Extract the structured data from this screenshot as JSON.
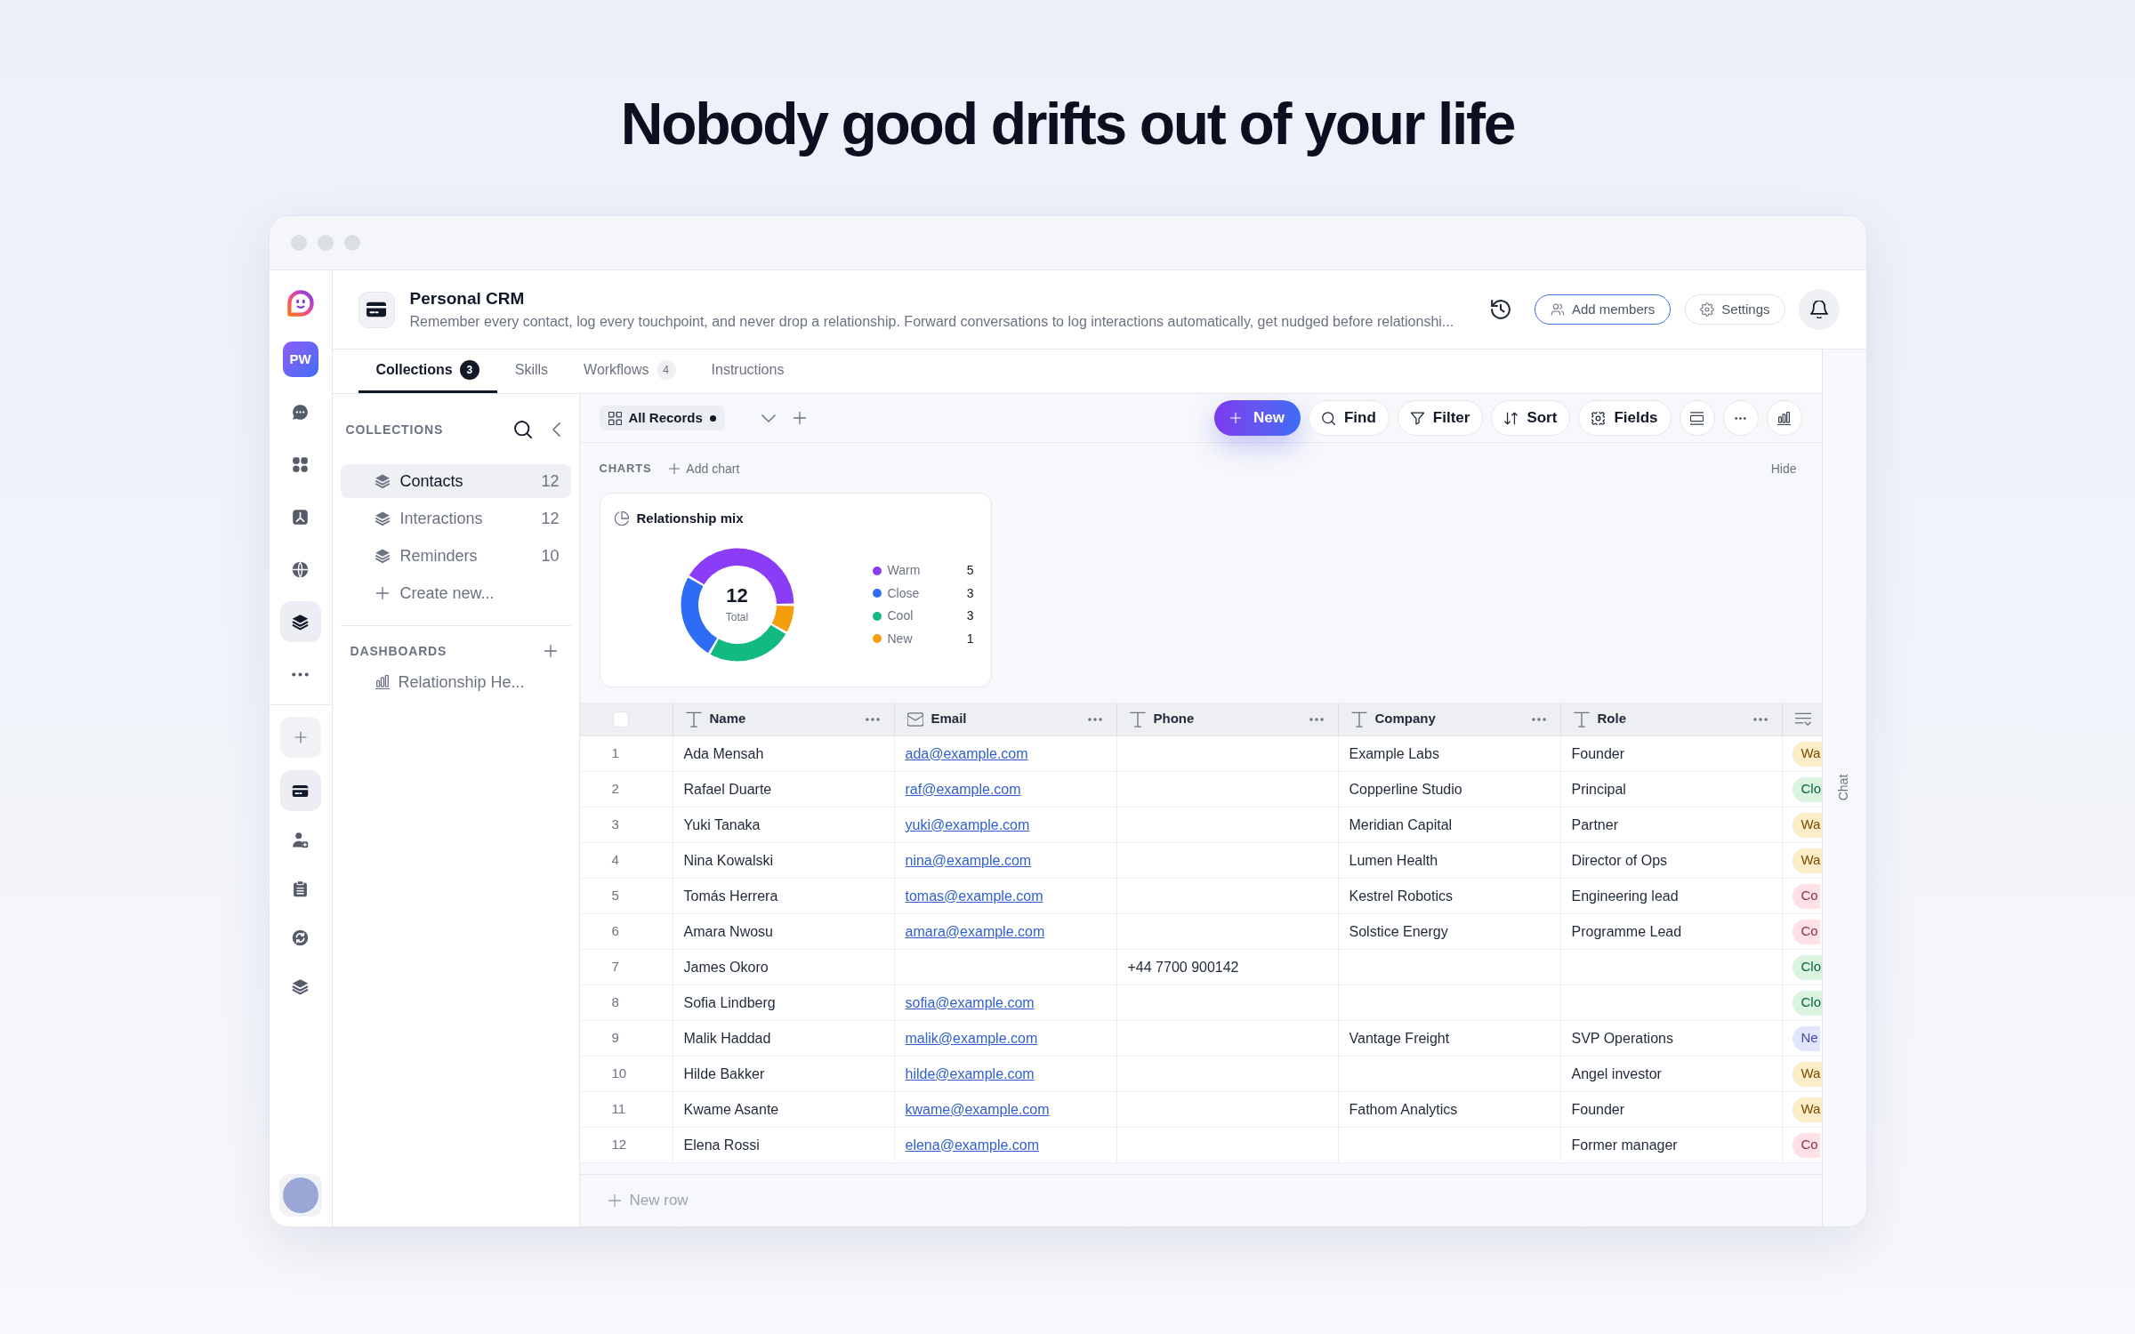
{
  "headline": "Nobody good drifts out of your life",
  "rail": {
    "workspace_badge": "PW",
    "apps": [
      {
        "selected": false
      },
      {
        "selected": false
      },
      {
        "selected": false
      },
      {
        "selected": false
      },
      {
        "selected": true
      }
    ],
    "pinned": [
      {
        "selected": true
      },
      {
        "selected": false
      },
      {
        "selected": false
      },
      {
        "selected": false
      },
      {
        "selected": false
      }
    ]
  },
  "workspace": {
    "title": "Personal CRM",
    "description": "Remember every contact, log every touchpoint, and never drop a relationship. Forward conversations to log interactions automatically, get nudged before relationshi...",
    "actions": [
      {
        "label": "Add members",
        "kind": "accent"
      },
      {
        "label": "Settings",
        "kind": "plain"
      }
    ]
  },
  "tabs": [
    {
      "label": "Collections",
      "badge": "3",
      "selected": true
    },
    {
      "label": "Skills",
      "selected": false
    },
    {
      "label": "Workflows",
      "badge": "4",
      "selected": false
    },
    {
      "label": "Instructions",
      "selected": false
    }
  ],
  "collections": {
    "heading": "COLLECTIONS",
    "items": [
      {
        "label": "Contacts",
        "count": "12",
        "selected": true
      },
      {
        "label": "Interactions",
        "count": "12",
        "selected": false
      },
      {
        "label": "Reminders",
        "count": "10",
        "selected": false
      }
    ],
    "create_label": "Create new..."
  },
  "dashboards": {
    "heading": "DASHBOARDS",
    "items": [
      {
        "label": "Relationship He...",
        "selected": false
      }
    ]
  },
  "toolbar": {
    "view": {
      "label": "All Records",
      "dot": true
    },
    "actions": [
      {
        "label": "New",
        "kind": "primary"
      },
      {
        "label": "Find",
        "kind": "plain"
      },
      {
        "label": "Filter",
        "kind": "plain"
      },
      {
        "label": "Sort",
        "kind": "plain"
      },
      {
        "label": "Fields",
        "kind": "plain"
      }
    ]
  },
  "charts": {
    "heading": "CHARTS",
    "add_label": "Add chart",
    "hide_label": "Hide",
    "cards": [
      {
        "chart_data": {
          "type": "donut",
          "title": "Relationship mix",
          "categories": [
            "Warm",
            "Close",
            "Cool",
            "New"
          ],
          "values": [
            41.67,
            25,
            25,
            8.33
          ]
        },
        "legend": [
          {
            "color": "#8b3cf6",
            "value": "5"
          },
          {
            "color": "#2f6cf5",
            "value": "3"
          },
          {
            "color": "#12b981",
            "value": "3"
          },
          {
            "color": "#f59e0b",
            "value": "1"
          }
        ],
        "total": {
          "value": "12",
          "label": "Total"
        }
      }
    ]
  },
  "table": {
    "select_all": {
      "checked": false
    },
    "columns": [
      {
        "label": "Name",
        "kind": "text"
      },
      {
        "label": "Email",
        "kind": "email"
      },
      {
        "label": "Phone",
        "kind": "text"
      },
      {
        "label": "Company",
        "kind": "text"
      },
      {
        "label": "Role",
        "kind": "text"
      },
      {
        "kind": "select"
      }
    ],
    "rows": [
      {
        "number": "1",
        "cells": [
          "Ada Mensah",
          "ada@example.com",
          null,
          "Example Labs",
          "Founder"
        ],
        "status": {
          "label": "Wa",
          "color": "#fdecc8"
        }
      },
      {
        "number": "2",
        "cells": [
          "Rafael Duarte",
          "raf@example.com",
          null,
          "Copperline Studio",
          "Principal"
        ],
        "status": {
          "label": "Clo",
          "color": "#dcf5e3"
        }
      },
      {
        "number": "3",
        "cells": [
          "Yuki Tanaka",
          "yuki@example.com",
          null,
          "Meridian Capital",
          "Partner"
        ],
        "status": {
          "label": "Wa",
          "color": "#fdecc8"
        }
      },
      {
        "number": "4",
        "cells": [
          "Nina Kowalski",
          "nina@example.com",
          null,
          "Lumen Health",
          "Director of Ops"
        ],
        "status": {
          "label": "Wa",
          "color": "#fdecc8"
        }
      },
      {
        "number": "5",
        "cells": [
          "Tomás Herrera",
          "tomas@example.com",
          null,
          "Kestrel Robotics",
          "Engineering lead"
        ],
        "status": {
          "label": "Co",
          "color": "#fde1e6"
        }
      },
      {
        "number": "6",
        "cells": [
          "Amara Nwosu",
          "amara@example.com",
          null,
          "Solstice Energy",
          "Programme Lead"
        ],
        "status": {
          "label": "Co",
          "color": "#fde1e6"
        }
      },
      {
        "number": "7",
        "cells": [
          "James Okoro",
          null,
          "+44 7700 900142",
          null,
          null
        ],
        "status": {
          "label": "Clo",
          "color": "#dcf5e3"
        }
      },
      {
        "number": "8",
        "cells": [
          "Sofia Lindberg",
          "sofia@example.com",
          null,
          null,
          null
        ],
        "status": {
          "label": "Clo",
          "color": "#dcf5e3"
        }
      },
      {
        "number": "9",
        "cells": [
          "Malik Haddad",
          "malik@example.com",
          null,
          "Vantage Freight",
          "SVP Operations"
        ],
        "status": {
          "label": "Ne",
          "color": "#e1e5fd"
        }
      },
      {
        "number": "10",
        "cells": [
          "Hilde Bakker",
          "hilde@example.com",
          null,
          null,
          "Angel investor"
        ],
        "status": {
          "label": "Wa",
          "color": "#fdecc8"
        }
      },
      {
        "number": "11",
        "cells": [
          "Kwame Asante",
          "kwame@example.com",
          null,
          "Fathom Analytics",
          "Founder"
        ],
        "status": {
          "label": "Wa",
          "color": "#fdecc8"
        }
      },
      {
        "number": "12",
        "cells": [
          "Elena Rossi",
          "elena@example.com",
          null,
          null,
          "Former manager"
        ],
        "status": {
          "label": "Co",
          "color": "#fde1e6"
        }
      }
    ],
    "new_row_label": "New row"
  },
  "chat_panel": {
    "label": "Chat"
  }
}
